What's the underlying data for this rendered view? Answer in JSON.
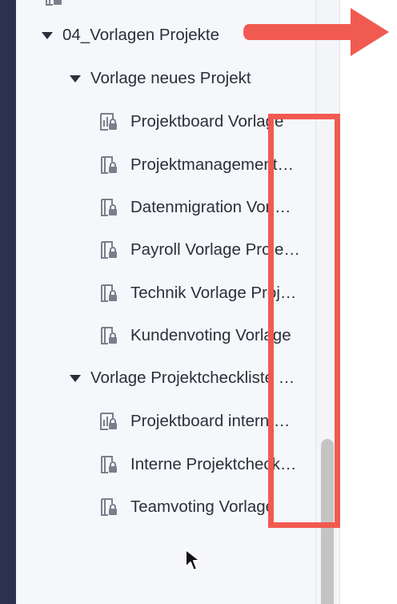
{
  "tree": {
    "folder": {
      "label": "04_Vorlagen Projekte"
    },
    "groups": [
      {
        "label": "Vorlage neues Projekt",
        "items": [
          {
            "label": "Projektboard Vorlage",
            "icon": "board-lock-icon"
          },
          {
            "label": "Projektmanagement…",
            "icon": "page-lock-icon"
          },
          {
            "label": "Datenmigration Vorl…",
            "icon": "page-lock-icon"
          },
          {
            "label": "Payroll Vorlage Proje…",
            "icon": "page-lock-icon"
          },
          {
            "label": "Technik Vorlage Proj…",
            "icon": "page-lock-icon"
          },
          {
            "label": "Kundenvoting Vorlage",
            "icon": "page-lock-icon"
          }
        ]
      },
      {
        "label": "Vorlage Projektcheckliste …",
        "items": [
          {
            "label": "Projektboard intern …",
            "icon": "board-lock-icon"
          },
          {
            "label": "Interne Projektcheck…",
            "icon": "page-lock-icon"
          },
          {
            "label": "Teamvoting Vorlage",
            "icon": "page-lock-icon"
          }
        ]
      }
    ]
  },
  "colors": {
    "sidebar_bg": "#f6f7fb",
    "left_rail": "#2c3150",
    "text": "#2b2f3a",
    "icon": "#7a7f8c",
    "annotation": "#f15a50",
    "scroll_thumb": "#c4c4c4"
  }
}
